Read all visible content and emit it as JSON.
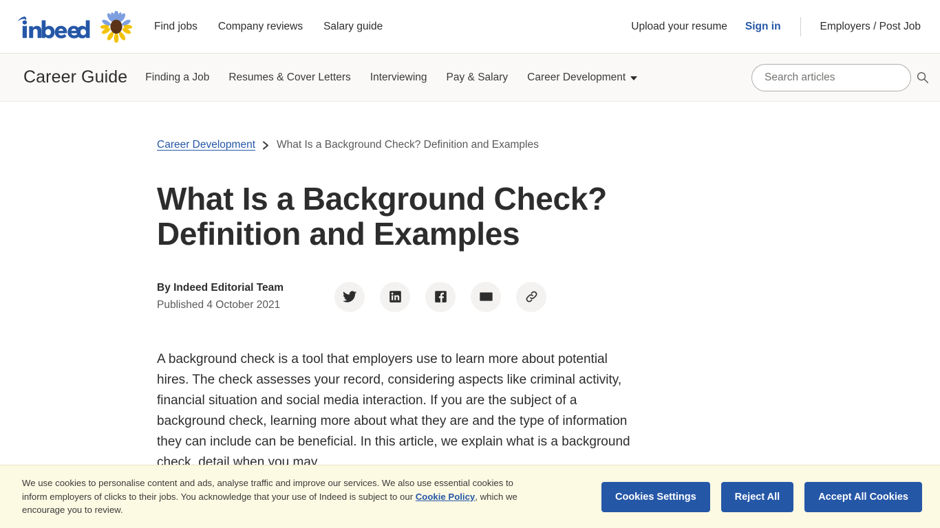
{
  "topnav": {
    "logo_text": "indeed",
    "sunflower_icon": "sunflower-icon",
    "links": [
      {
        "label": "Find jobs",
        "name": "find-jobs"
      },
      {
        "label": "Company reviews",
        "name": "company-reviews"
      },
      {
        "label": "Salary guide",
        "name": "salary-guide"
      }
    ],
    "upload_resume": "Upload your resume",
    "sign_in": "Sign in",
    "employers": "Employers / Post Job"
  },
  "guidebar": {
    "title": "Career Guide",
    "links": [
      {
        "label": "Finding a Job",
        "name": "finding-a-job",
        "caret": false
      },
      {
        "label": "Resumes & Cover Letters",
        "name": "resumes-cover-letters",
        "caret": false
      },
      {
        "label": "Interviewing",
        "name": "interviewing",
        "caret": false
      },
      {
        "label": "Pay & Salary",
        "name": "pay-salary",
        "caret": false
      },
      {
        "label": "Career Development",
        "name": "career-development",
        "caret": true
      }
    ],
    "search": {
      "placeholder": "Search articles",
      "value": "",
      "icon": "search-icon"
    }
  },
  "breadcrumb": {
    "parent": "Career Development",
    "separator_icon": "chevron-right-icon",
    "current": "What Is a Background Check? Definition and Examples"
  },
  "article": {
    "title": "What Is a Background Check? Definition and Examples",
    "author": "By Indeed Editorial Team",
    "published": "Published 4 October 2021",
    "share_buttons": [
      {
        "name": "share-twitter-button",
        "icon": "twitter-icon"
      },
      {
        "name": "share-linkedin-button",
        "icon": "linkedin-icon"
      },
      {
        "name": "share-facebook-button",
        "icon": "facebook-icon"
      },
      {
        "name": "share-email-button",
        "icon": "envelope-icon"
      },
      {
        "name": "share-link-button",
        "icon": "link-icon"
      }
    ],
    "body_paragraph": "A background check is a tool that employers use to learn more about potential hires. The check assesses your record, considering aspects like criminal activity, financial situation and social media interaction. If you are the subject of a background check, learning more about what they are and the type of information they can include can be beneficial. In this article, we explain what is a background check, detail when you may"
  },
  "cookie_banner": {
    "text_part1": "We use cookies to personalise content and ads, analyse traffic and improve our services. We also use essential cookies to inform employers of clicks to their jobs. You acknowledge that your use of Indeed is subject to our ",
    "link_text": "Cookie Policy",
    "text_part2": ", which we encourage you to review.",
    "buttons": [
      {
        "label": "Cookies Settings",
        "name": "cookies-settings-button"
      },
      {
        "label": "Reject All",
        "name": "reject-all-button"
      },
      {
        "label": "Accept All Cookies",
        "name": "accept-all-cookies-button"
      }
    ]
  },
  "colors": {
    "indeed_blue": "#2557a7",
    "text_dark": "#2d2d2d",
    "guidebar_bg": "#faf9f7",
    "cookie_bg": "#fdfae3",
    "share_bg": "#f3f2f1"
  }
}
